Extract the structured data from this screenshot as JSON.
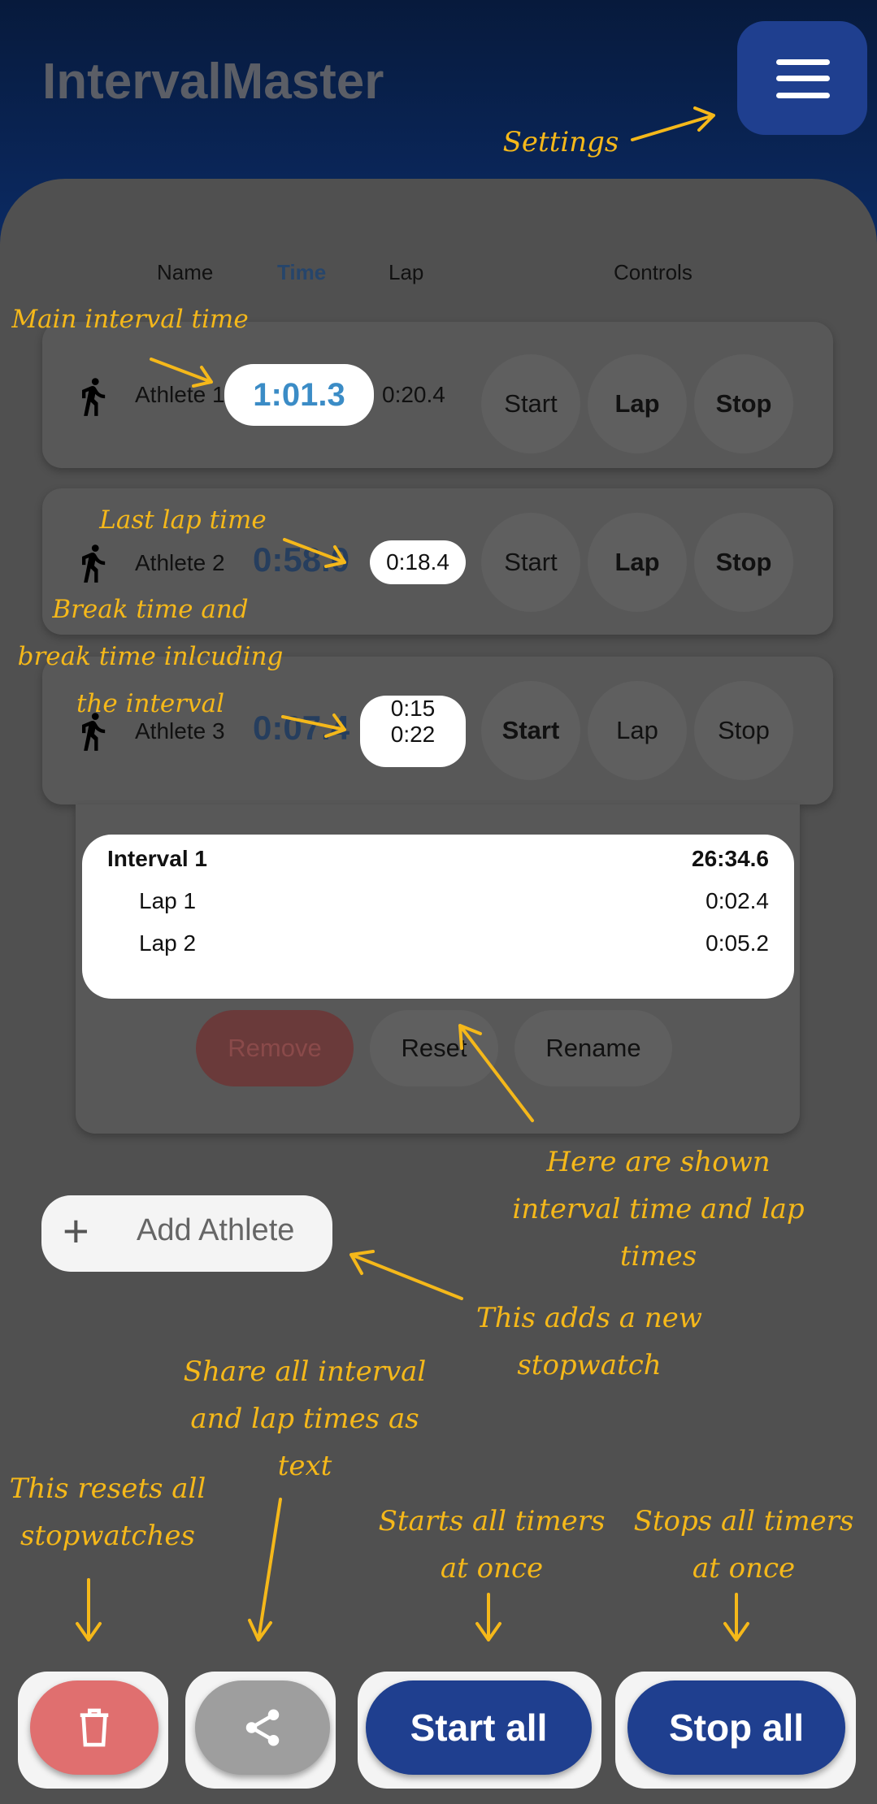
{
  "app": {
    "title": "IntervalMaster"
  },
  "columns": {
    "name": "Name",
    "time": "Time",
    "lap": "Lap",
    "controls": "Controls"
  },
  "athletes": [
    {
      "name": "Athlete 1",
      "time": "1:01.3",
      "lap": "0:20.4",
      "start": "Start",
      "lap_label": "Lap",
      "stop": "Stop"
    },
    {
      "name": "Athlete 2",
      "time": "0:58.0",
      "lap": "0:18.4",
      "start": "Start",
      "lap_label": "Lap",
      "stop": "Stop"
    },
    {
      "name": "Athlete 3",
      "time": "0:07.4",
      "break_time": "0:15",
      "break_total": "0:22",
      "start": "Start",
      "lap_label": "Lap",
      "stop": "Stop"
    }
  ],
  "detail": {
    "interval_label": "Interval 1",
    "interval_time": "26:34.6",
    "laps": [
      {
        "label": "Lap 1",
        "time": "0:02.4"
      },
      {
        "label": "Lap 2",
        "time": "0:05.2"
      }
    ],
    "remove": "Remove",
    "reset": "Reset",
    "rename": "Rename"
  },
  "add_athlete": {
    "icon": "plus-icon",
    "label": "Add Athlete"
  },
  "bottom": {
    "delete_icon": "trash-icon",
    "share_icon": "share-icon",
    "start_all": "Start all",
    "stop_all": "Stop all"
  },
  "annotations": {
    "settings": "Settings",
    "main_time": "Main interval time",
    "last_lap": "Last lap time",
    "break_line1": "Break time and",
    "break_line2": "break time inlcuding",
    "break_line3": "the interval",
    "shown_line1": "Here are shown",
    "shown_line2": "interval time and lap",
    "shown_line3": "times",
    "adds_line1": "This adds a new",
    "adds_line2": "stopwatch",
    "share_line1": "Share all interval",
    "share_line2": "and lap times as",
    "share_line3": "text",
    "reset_line1": "This resets all",
    "reset_line2": "stopwatches",
    "start_line1": "Starts all timers",
    "start_line2": "at once",
    "stop_line1": "Stops all timers",
    "stop_line2": "at once"
  },
  "colors": {
    "header": "#0b2a63",
    "accent_blue": "#1f3f8f",
    "time_blue": "#3b8cc6",
    "annotation": "#f5b81a",
    "delete_red": "#e06f6f"
  }
}
